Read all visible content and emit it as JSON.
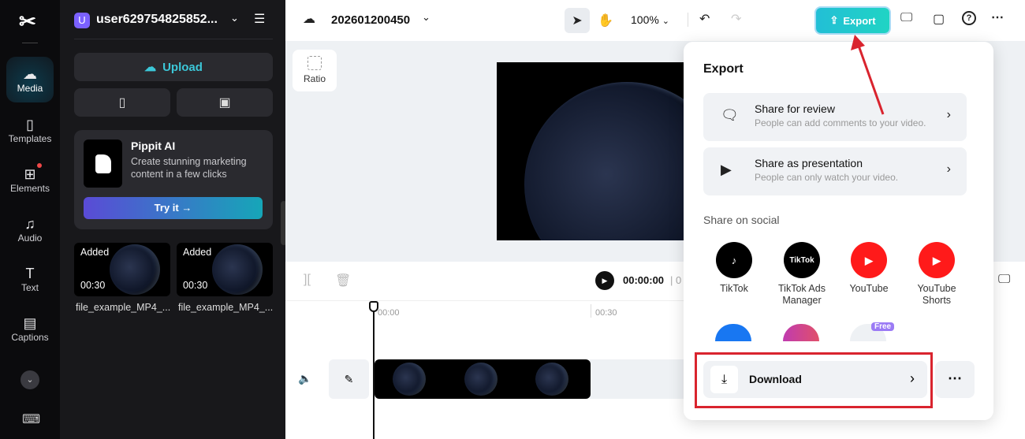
{
  "nav": {
    "items": [
      {
        "label": "Media",
        "icon": "cloud-upload-icon"
      },
      {
        "label": "Templates",
        "icon": "templates-icon"
      },
      {
        "label": "Elements",
        "icon": "elements-icon"
      },
      {
        "label": "Audio",
        "icon": "music-icon"
      },
      {
        "label": "Text",
        "icon": "text-icon"
      },
      {
        "label": "Captions",
        "icon": "captions-icon"
      }
    ]
  },
  "panel": {
    "avatar": "U",
    "username": "user629754825852...",
    "upload": "Upload",
    "promo": {
      "title": "Pippit AI",
      "desc": "Create stunning marketing content in a few clicks",
      "cta": "Try it →"
    },
    "media": [
      {
        "badge": "Added",
        "duration": "00:30",
        "name": "file_example_MP4_..."
      },
      {
        "badge": "Added",
        "duration": "00:30",
        "name": "file_example_MP4_..."
      }
    ]
  },
  "topbar": {
    "project": "202601200450",
    "zoom": "100%",
    "export": "Export"
  },
  "canvas": {
    "ratio": "Ratio"
  },
  "timeline": {
    "time": "00:00:00",
    "sep": "| 0",
    "ticks": [
      "00:00",
      "00:30"
    ]
  },
  "export": {
    "title": "Export",
    "options": [
      {
        "title": "Share for review",
        "sub": "People can add comments to your video."
      },
      {
        "title": "Share as presentation",
        "sub": "People can only watch your video."
      }
    ],
    "social_label": "Share on social",
    "social": [
      {
        "name": "TikTok",
        "color": "#000000"
      },
      {
        "name": "TikTok Ads Manager",
        "color": "#000000"
      },
      {
        "name": "YouTube",
        "color": "#ff1a1a"
      },
      {
        "name": "YouTube Shorts",
        "color": "#ff1a1a"
      }
    ],
    "free_badge": "Free",
    "download": "Download"
  },
  "colors": {
    "accent": "#22c4d4",
    "annotation": "#d9242e"
  }
}
